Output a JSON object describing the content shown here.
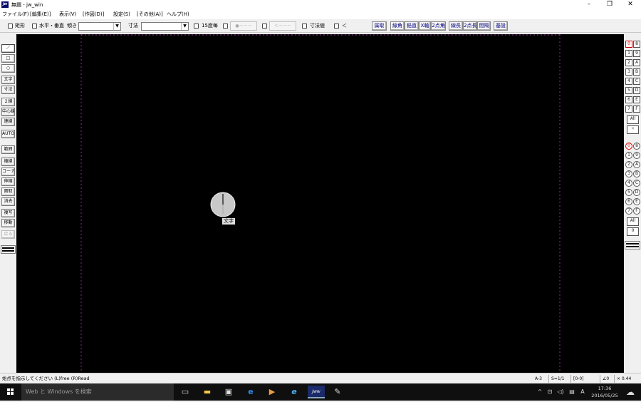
{
  "window": {
    "app_icon": "jw",
    "title": "無題 - jw_win",
    "minimize": "–",
    "maximize": "❐",
    "close": "✕"
  },
  "menu": [
    "ファイル(F)",
    "[編集(E)]",
    "表示(V)",
    "[作図(D)]",
    "設定(S)",
    "[その他(A)]",
    "ヘルプ(H)"
  ],
  "toolbar": {
    "rect_label": "矩形",
    "hv_label": "水平・垂直",
    "tilt_label": "傾き",
    "tilt_value": "",
    "dim_label": "寸法",
    "dim_value": "",
    "deg15_label": "15度毎",
    "btn_a": "●－－－",
    "btn_b": "＜－－－",
    "dimval_label": "寸法値",
    "lt_label": "＜",
    "buttons": [
      "属取",
      "線角",
      "鉛直",
      "X軸",
      "2点角",
      "線長",
      "2点長",
      "間隔",
      "基設"
    ]
  },
  "left_tools": [
    "／",
    "□",
    "○",
    "文字",
    "寸法",
    "２線",
    "中心線",
    "連線",
    "AUTO",
    "範囲",
    "複線",
    "コーナー",
    "伸縮",
    "面取",
    "消去",
    "複写",
    "移動",
    "戻る"
  ],
  "right_layer_group_buttons": [
    "0",
    "8",
    "1",
    "9",
    "2",
    "A",
    "3",
    "B",
    "4",
    "C",
    "5",
    "D",
    "6",
    "E",
    "7",
    "F"
  ],
  "right_layer_group_all": "All",
  "right_layer_group_x": "✕",
  "right_layer_buttons": [
    "0",
    "8",
    "1",
    "9",
    "2",
    "A",
    "3",
    "B",
    "4",
    "C",
    "5",
    "D",
    "6",
    "E",
    "7",
    "F"
  ],
  "right_layer_all": "All",
  "right_layer_zero": "0",
  "canvas": {
    "cursor_label": "文字"
  },
  "status": {
    "message": "始点を指示してください (L)free (R)Read",
    "paper": "A-3",
    "scale": "S=1/1",
    "layer": "[0-0]",
    "angle": "∠0",
    "zoom": "× 0.44"
  },
  "taskbar": {
    "search_placeholder": "Web と Windows を検索",
    "ime": "A",
    "time": "17:36",
    "date": "2016/05/25"
  },
  "colors": {
    "canvas_bg": "#000000",
    "frame_dash": "#8a2f8a",
    "active_layer": "#cc0000",
    "toolbar_text": "#000080"
  }
}
